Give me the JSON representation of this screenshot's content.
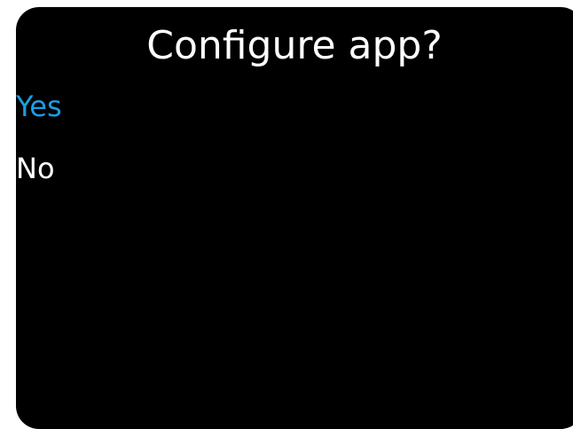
{
  "dialog": {
    "title": "Configure app?",
    "options": [
      {
        "label": "Yes",
        "selected": true
      },
      {
        "label": "No",
        "selected": false
      }
    ]
  },
  "colors": {
    "background": "#000000",
    "selected_text": "#1a9ee5",
    "normal_text": "#ffffff"
  }
}
